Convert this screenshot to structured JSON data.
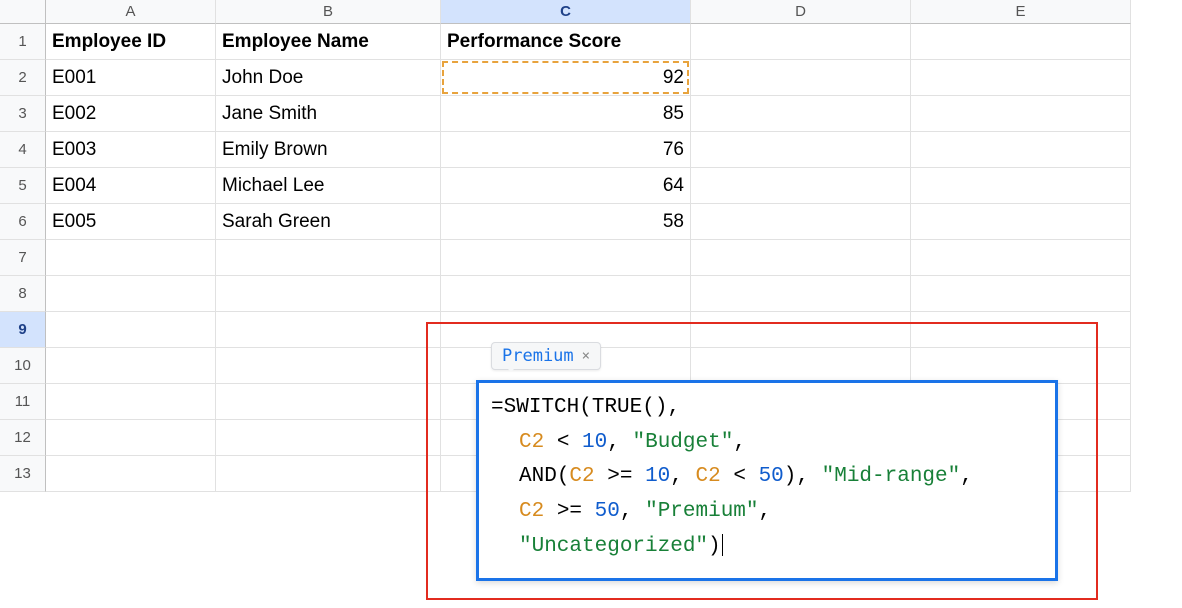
{
  "columns": [
    "A",
    "B",
    "C",
    "D",
    "E"
  ],
  "selected_column_index": 2,
  "row_count": 13,
  "selected_row": 9,
  "headers": {
    "A": "Employee ID",
    "B": "Employee Name",
    "C": "Performance Score"
  },
  "rows": [
    {
      "A": "E001",
      "B": "John Doe",
      "C": "92"
    },
    {
      "A": "E002",
      "B": "Jane Smith",
      "C": "85"
    },
    {
      "A": "E003",
      "B": "Emily Brown",
      "C": "76"
    },
    {
      "A": "E004",
      "B": "Michael Lee",
      "C": "64"
    },
    {
      "A": "E005",
      "B": "Sarah Green",
      "C": "58"
    }
  ],
  "copied_cell": "C2",
  "tooltip": {
    "text": "Premium",
    "close": "×"
  },
  "formula": {
    "raw": "=SWITCH(TRUE(),\n  C2 < 10, \"Budget\",\n  AND(C2 >= 10, C2 < 50), \"Mid-range\",\n  C2 >= 50, \"Premium\",\n  \"Uncategorized\")",
    "tokens": {
      "eq": "=",
      "switch": "SWITCH",
      "true": "TRUE",
      "and": "AND",
      "c2": "C2",
      "lt": "<",
      "gte": ">=",
      "n10": "10",
      "n50": "50",
      "budget": "\"Budget\"",
      "midrange": "\"Mid-range\"",
      "premium": "\"Premium\"",
      "uncat": "\"Uncategorized\""
    }
  }
}
